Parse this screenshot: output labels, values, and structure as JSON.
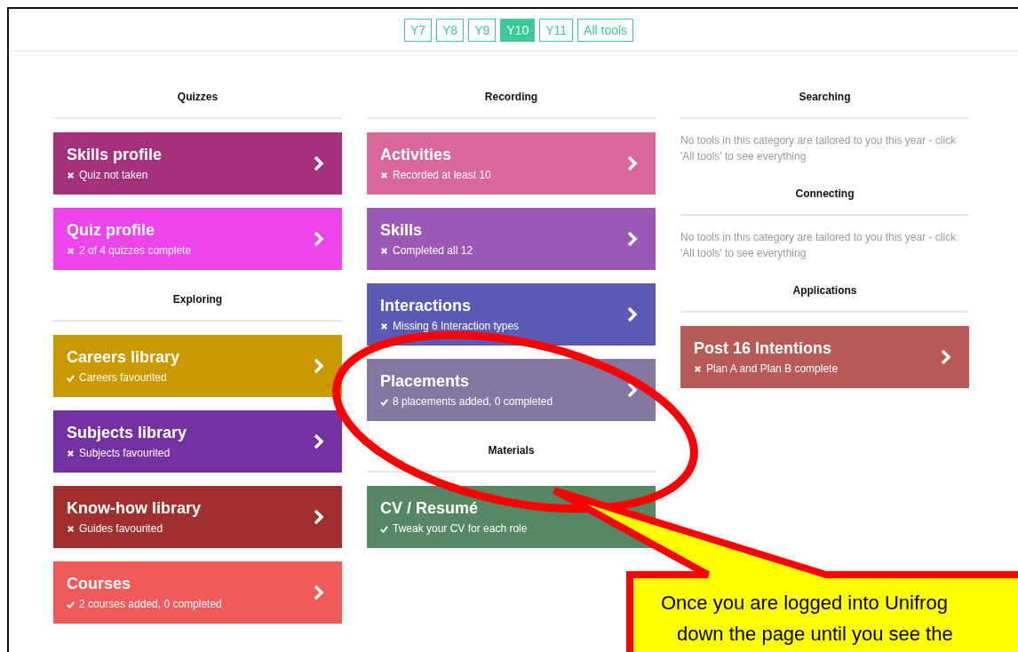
{
  "year_tabs": [
    {
      "label": "Y7",
      "selected": false
    },
    {
      "label": "Y8",
      "selected": false
    },
    {
      "label": "Y9",
      "selected": false
    },
    {
      "label": "Y10",
      "selected": true
    },
    {
      "label": "Y11",
      "selected": false
    },
    {
      "label": "All tools",
      "selected": false
    }
  ],
  "columns": [
    {
      "sections": [
        {
          "title": "Quizzes",
          "cards": [
            {
              "title": "Skills profile",
              "status": "Quiz not taken",
              "complete": false,
              "color": "#a3317b"
            },
            {
              "title": "Quiz profile",
              "status": "2 of 4 quizzes complete",
              "complete": false,
              "color": "#ec45ec"
            }
          ]
        },
        {
          "title": "Exploring",
          "cards": [
            {
              "title": "Careers library",
              "status": "Careers favourited",
              "complete": true,
              "color": "#c89a00"
            },
            {
              "title": "Subjects library",
              "status": "Subjects favourited",
              "complete": false,
              "color": "#7232a0"
            },
            {
              "title": "Know-how library",
              "status": "Guides favourited",
              "complete": false,
              "color": "#a0302e"
            },
            {
              "title": "Courses",
              "status": "2 courses added, 0 completed",
              "complete": true,
              "color": "#f05a5a"
            }
          ]
        }
      ]
    },
    {
      "sections": [
        {
          "title": "Recording",
          "cards": [
            {
              "title": "Activities",
              "status": "Recorded at least 10",
              "complete": false,
              "color": "#d9679b"
            },
            {
              "title": "Skills",
              "status": "Completed all 12",
              "complete": false,
              "color": "#9b59b6"
            },
            {
              "title": "Interactions",
              "status": "Missing 6 Interaction types",
              "complete": false,
              "color": "#5b5bb5"
            },
            {
              "title": "Placements",
              "status": "8 placements added, 0 completed",
              "complete": true,
              "color": "#8478a3"
            }
          ]
        },
        {
          "title": "Materials",
          "cards": [
            {
              "title": "CV / Resumé",
              "status": "Tweak your CV for each role",
              "complete": true,
              "color": "#558764"
            }
          ]
        }
      ]
    },
    {
      "sections": [
        {
          "title": "Searching",
          "empty_message": "No tools in this category are tailored to you this year - click 'All tools' to see everything"
        },
        {
          "title": "Connecting",
          "empty_message": "No tools in this category are tailored to you this year - click 'All tools' to see everything"
        },
        {
          "title": "Applications",
          "cards": [
            {
              "title": "Post 16 Intentions",
              "status": "Plan A and Plan B complete",
              "complete": false,
              "color": "#b85b58"
            }
          ]
        }
      ]
    }
  ],
  "callout": {
    "lines": [
      "Once you are logged into Unifrog",
      "down the page until you see the"
    ]
  }
}
